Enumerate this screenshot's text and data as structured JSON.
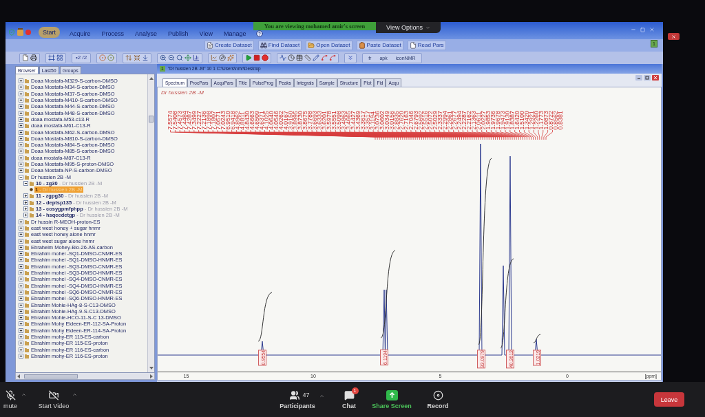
{
  "meeting_banner": {
    "text": "You are viewing mohamed amir's screen",
    "view_options": "View Options"
  },
  "window": {
    "menu": [
      {
        "label": "Start",
        "highlighted": true
      },
      {
        "label": "Acquire",
        "highlighted": false
      },
      {
        "label": "Process",
        "highlighted": false
      },
      {
        "label": "Analyse",
        "highlighted": false
      },
      {
        "label": "Publish",
        "highlighted": false
      },
      {
        "label": "View",
        "highlighted": false
      },
      {
        "label": "Manage",
        "highlighted": false
      }
    ],
    "toolbar_actions": [
      {
        "label": "Create Dataset",
        "kind": "new"
      },
      {
        "label": "Find Dataset",
        "kind": "find"
      },
      {
        "label": "Open Dataset",
        "kind": "open"
      },
      {
        "label": "Paste Dataset",
        "kind": "paste"
      },
      {
        "label": "Read Pars",
        "kind": "read"
      }
    ],
    "workspace_number": "1",
    "page_counter": "•2 /2",
    "commands": [
      "fr",
      "apk",
      "iconNMR"
    ]
  },
  "browser": {
    "tabs": [
      {
        "label": "Browser",
        "selected": true
      },
      {
        "label": "Last50",
        "selected": false
      },
      {
        "label": "Groups",
        "selected": false
      }
    ],
    "tree": [
      {
        "label": "Doaa Mostafa-M329-S-carbon-DMSO",
        "expanded": false,
        "selected": false
      },
      {
        "label": "Doaa Mostafa-M34-S-carbon-DMSO",
        "expanded": false,
        "selected": false
      },
      {
        "label": "Doaa Mostafa-M37-S-carbon-DMSO",
        "expanded": false,
        "selected": false
      },
      {
        "label": "Doaa Mostafa-M410-S-carbon-DMSO",
        "expanded": false,
        "selected": false
      },
      {
        "label": "Doaa Mostafa-M44-S-carbon-DMSO",
        "expanded": false,
        "selected": false
      },
      {
        "label": "Doaa Mostafa-M48-S-carbon-DMSO",
        "expanded": false,
        "selected": false
      },
      {
        "label": "doaa mostafa-M53-c13-R",
        "expanded": false,
        "selected": false
      },
      {
        "label": "doaa mostafa-M61-C13-R",
        "expanded": false,
        "selected": false
      },
      {
        "label": "Doaa Mostafa-M62-S-carbon-DMSO",
        "expanded": false,
        "selected": false
      },
      {
        "label": "Doaa Mostafa-M810-S-carbon-DMSO",
        "expanded": false,
        "selected": false
      },
      {
        "label": "Doaa Mostafa-M84-S-carbon-DMSO",
        "expanded": false,
        "selected": false
      },
      {
        "label": "Doaa Mostafa-M85-S-carbon-DMSO",
        "expanded": false,
        "selected": false
      },
      {
        "label": "doaa mostafa-M87-C13-R",
        "expanded": false,
        "selected": false
      },
      {
        "label": "Doaa Mostafa-M95-S-proton-DMSO",
        "expanded": false,
        "selected": false
      },
      {
        "label": "Doaa Mostafa-NP-S-carbon-DMSO",
        "expanded": false,
        "selected": false
      },
      {
        "label": "Dr hussien 2B -M",
        "expanded": true,
        "selected": false,
        "children": [
          {
            "label": "10 - zg30",
            "note": "- Dr hussien 2B -M",
            "expanded": true,
            "selected": false,
            "children": [
              {
                "label": "1",
                "note": "- Dr hussien 2B -M",
                "selected": true
              }
            ]
          },
          {
            "label": "11 - zgpg30",
            "note": "- Dr hussien 2B -M",
            "expanded": false,
            "selected": false
          },
          {
            "label": "12 - deptsp135",
            "note": "- Dr hussien 2B -M",
            "expanded": false,
            "selected": false
          },
          {
            "label": "13 - cosygpmfphpp",
            "note": "- Dr hussien 2B -M",
            "expanded": false,
            "selected": false
          },
          {
            "label": "14 - hsqcedetgp",
            "note": "- Dr hussien 2B -M",
            "expanded": false,
            "selected": false
          }
        ]
      },
      {
        "label": "Dr hussin R-MEOH-proton-ES",
        "expanded": false,
        "selected": false
      },
      {
        "label": "east west honey + sugar hnmr",
        "expanded": false,
        "selected": false
      },
      {
        "label": "east west honey alone hnmr",
        "expanded": false,
        "selected": false
      },
      {
        "label": "east west sugar alone hnmr",
        "expanded": false,
        "selected": false
      },
      {
        "label": "Ebraheim Mohey-Bio-26-AS-carbon",
        "expanded": false,
        "selected": false
      },
      {
        "label": "Ebrahim mohei -SQ1-DMSO-CNMR-ES",
        "expanded": false,
        "selected": false
      },
      {
        "label": "Ebrahim mohei -SQ1-DMSO-HNMR-ES",
        "expanded": false,
        "selected": false
      },
      {
        "label": "Ebrahim mohei -SQ3-DMSO-CNMR-ES",
        "expanded": false,
        "selected": false
      },
      {
        "label": "Ebrahim mohei -SQ3-DMSO-HNMR-ES",
        "expanded": false,
        "selected": false
      },
      {
        "label": "Ebrahim mohei -SQ4-DMSO-CNMR-ES",
        "expanded": false,
        "selected": false
      },
      {
        "label": "Ebrahim mohei -SQ4-DMSO-HNMR-ES",
        "expanded": false,
        "selected": false
      },
      {
        "label": "Ebrahim mohei -SQ6-DMSO-CNMR-ES",
        "expanded": false,
        "selected": false
      },
      {
        "label": "Ebrahim mohei -SQ6-DMSO-HNMR-ES",
        "expanded": false,
        "selected": false
      },
      {
        "label": "Ebrahim Mohie-HAg-8-S-C13-DMSO",
        "expanded": false,
        "selected": false
      },
      {
        "label": "Ebrahim Mohie-HAg-9-S-C13-DMSO",
        "expanded": false,
        "selected": false
      },
      {
        "label": "Ebrahim Mohie-HCO-11-S-C 13-DMSO",
        "expanded": false,
        "selected": false
      },
      {
        "label": "Ebrahim Mohy Eldeen-ER-112-SA-Proton",
        "expanded": false,
        "selected": false
      },
      {
        "label": "Ebrahim Mohy Eldeen-ER-114-SA-Proton",
        "expanded": false,
        "selected": false
      },
      {
        "label": "Ebrahim mohy-ER 115-ES-carbon",
        "expanded": false,
        "selected": false
      },
      {
        "label": "Ebrahim mohy-ER 115-ES-proton",
        "expanded": false,
        "selected": false
      },
      {
        "label": "Ebrahim mohy-ER 116-ES-carbon",
        "expanded": false,
        "selected": false
      },
      {
        "label": "Ebrahim mohy-ER 116-ES-proton",
        "expanded": false,
        "selected": false
      }
    ]
  },
  "dataset_window": {
    "number": "1",
    "title": "\"Dr hussien 2B -M\" 10 1 C:\\Users\\nmr\\Desktop",
    "tabs": [
      {
        "label": "Spectrum",
        "selected": true
      },
      {
        "label": "ProcPars",
        "selected": false
      },
      {
        "label": "AcquPars",
        "selected": false
      },
      {
        "label": "Title",
        "selected": false
      },
      {
        "label": "PulseProg",
        "selected": false
      },
      {
        "label": "Peaks",
        "selected": false
      },
      {
        "label": "Integrals",
        "selected": false
      },
      {
        "label": "Sample",
        "selected": false
      },
      {
        "label": "Structure",
        "selected": false
      },
      {
        "label": "Plot",
        "selected": false
      },
      {
        "label": "Fid",
        "selected": false
      },
      {
        "label": "Acqu",
        "selected": false
      }
    ],
    "spectrum": {
      "title": "Dr hussien 2B -M",
      "peak_labels": [
        "7.5574",
        "7.5408",
        "7.4573",
        "7.4484",
        "7.4287",
        "7.3499",
        "7.2227",
        "7.2136",
        "7.1898",
        "7.1807",
        "7.0571",
        "7.0243",
        "6.9510",
        "6.9418",
        "4.8962",
        "4.8811",
        "4.8430",
        "4.6663",
        "4.6509",
        "4.6371",
        "4.1025",
        "4.0640",
        "4.0546",
        "4.0262",
        "4.0167",
        "3.9150",
        "3.8995",
        "3.8730",
        "3.8675",
        "3.7788",
        "3.6693",
        "3.6333",
        "3.6201",
        "3.5978",
        "3.5551",
        "3.5098",
        "3.4863",
        "3.4665",
        "3.4427",
        "3.4369",
        "3.3617",
        "3.3517",
        "3.1194",
        "3.0736",
        "3.0602",
        "3.0349",
        "3.0156",
        "2.8835",
        "2.7620",
        "2.7163",
        "2.7046",
        "2.6793",
        "2.5692",
        "2.5516",
        "2.5072",
        "2.5029",
        "2.3337",
        "2.2994",
        "2.2861",
        "2.2677",
        "2.2494",
        "2.2287",
        "2.2162",
        "2.1363",
        "2.0611",
        "2.0227",
        "1.9853",
        "1.9736",
        "1.9678",
        "1.9473",
        "1.9130",
        "1.8387",
        "1.6420",
        "1.5100",
        "1.3420",
        "1.2921",
        "1.2260",
        "1.1773",
        "1.0873",
        "0.8722",
        "0.8562",
        "0.8381"
      ],
      "integrals": [
        "0.9554",
        "6.1194",
        "33.0979",
        "40.2612",
        "1.0219"
      ],
      "axis": {
        "ticks": [
          "15",
          "10",
          "5",
          "0"
        ],
        "unit": "[ppm]"
      }
    }
  },
  "meeting_controls": {
    "audio": {
      "label": "mute",
      "muted": true
    },
    "video": {
      "label": "Start Video",
      "on": false
    },
    "participants": {
      "label": "Participants",
      "count": "47"
    },
    "chat": {
      "label": "Chat",
      "badge": "1"
    },
    "share": "Share Screen",
    "record": "Record",
    "leave": "Leave"
  }
}
